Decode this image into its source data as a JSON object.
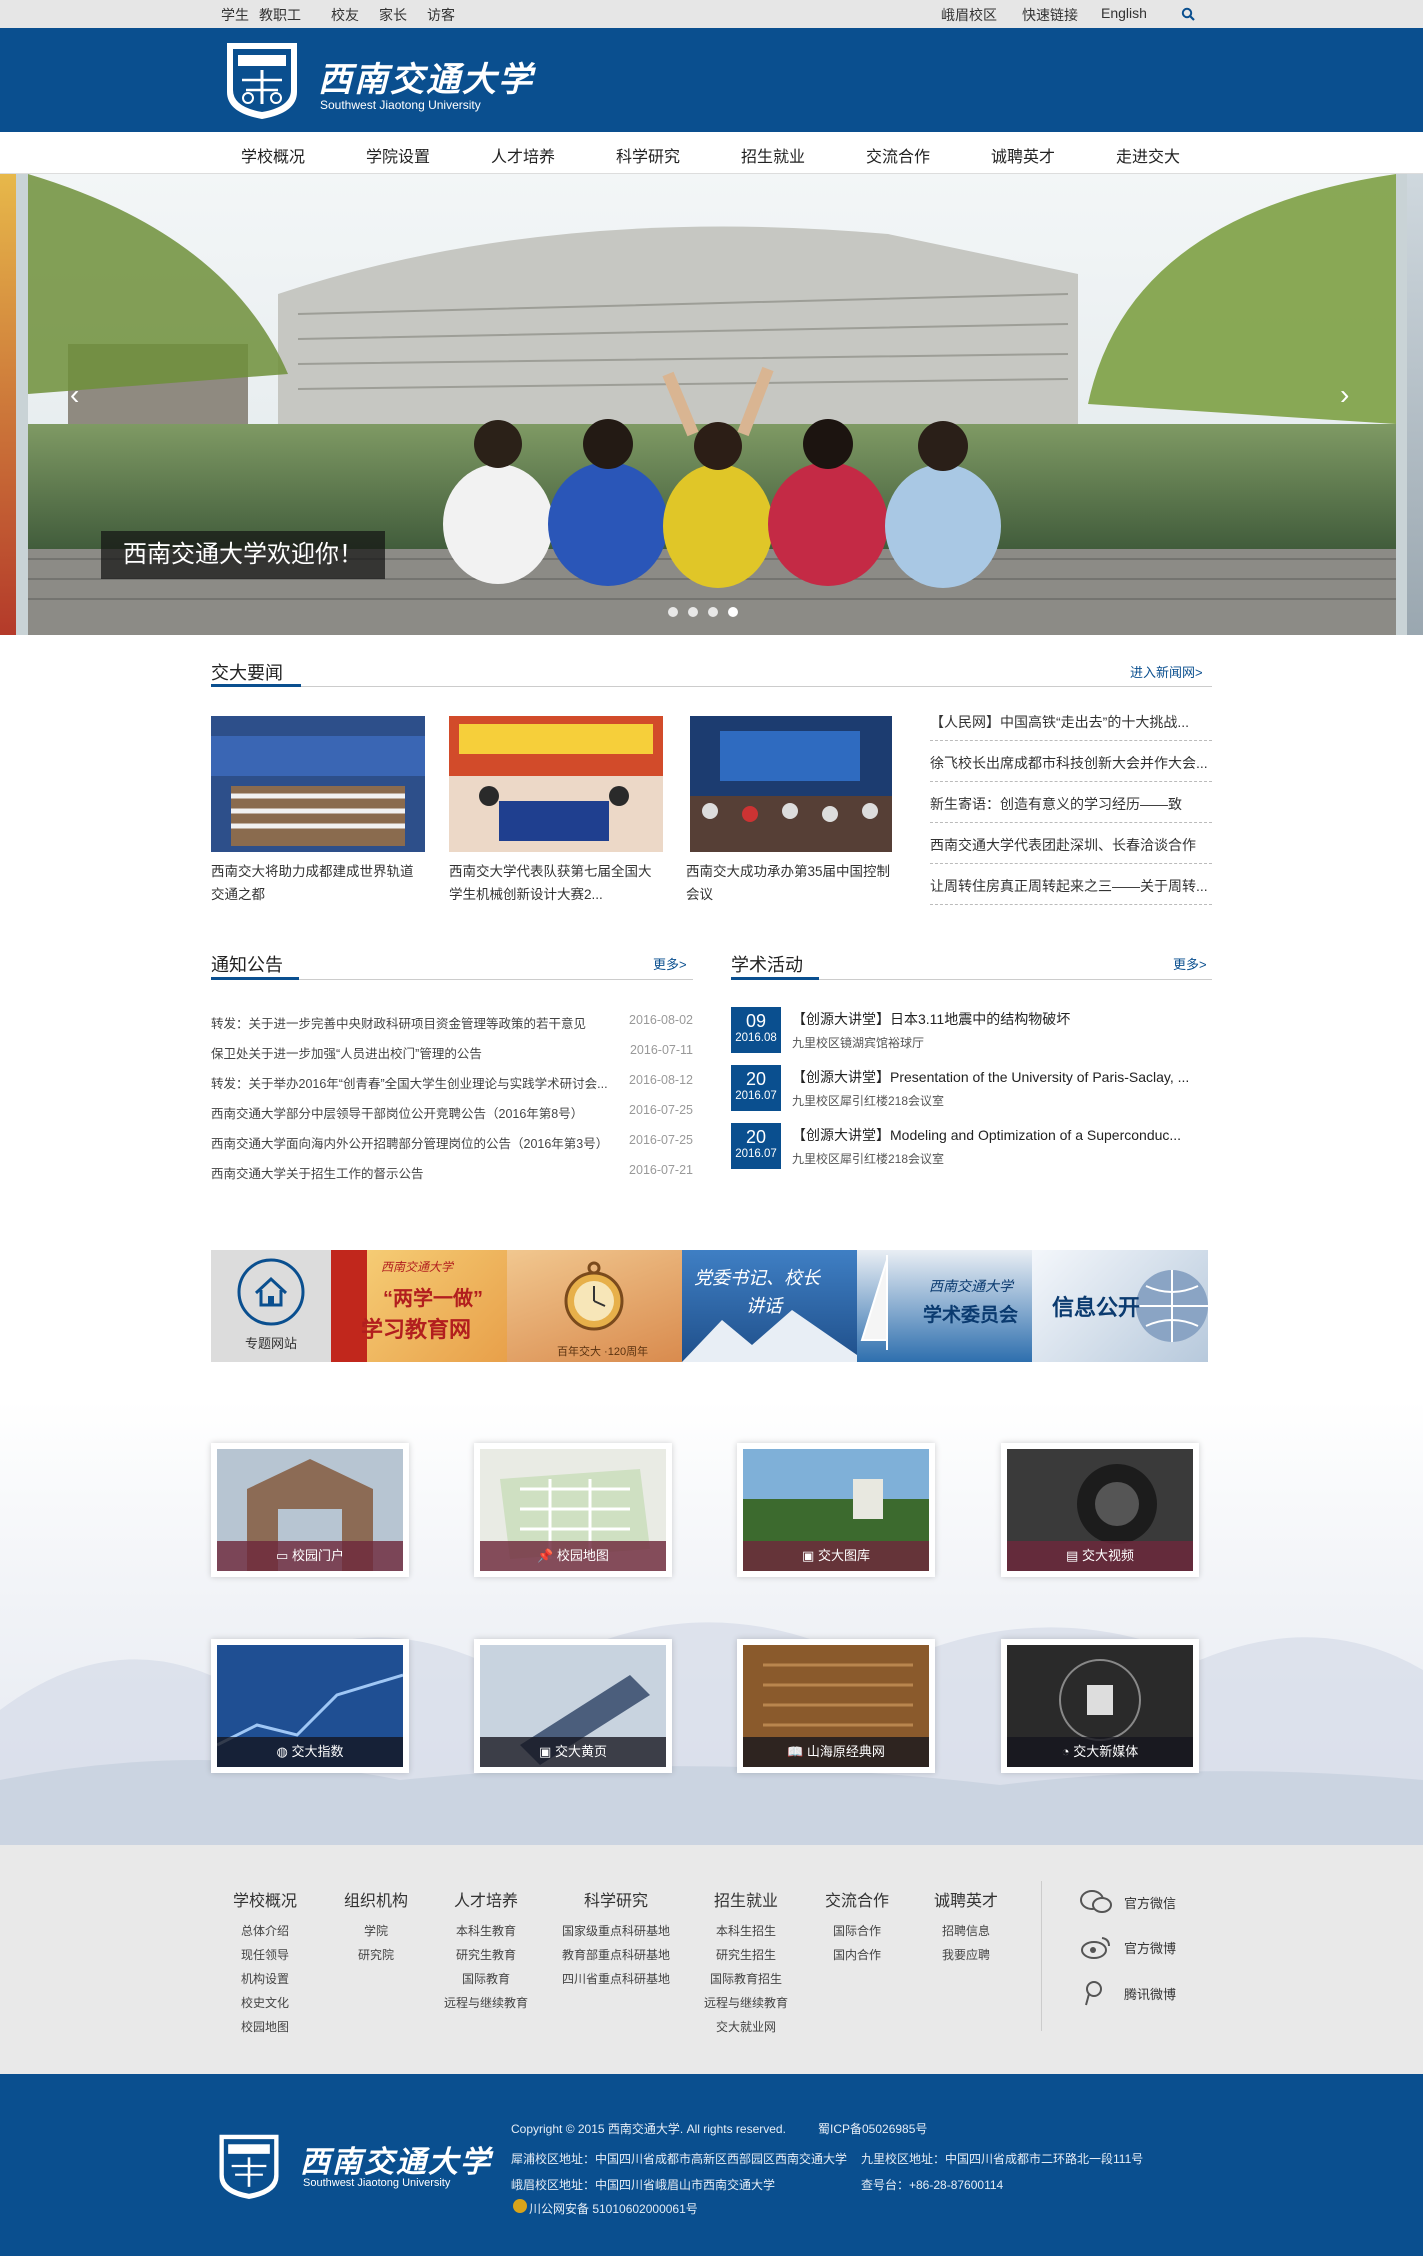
{
  "topbar": {
    "left": [
      "学生",
      "教职工",
      "校友",
      "家长",
      "访客"
    ],
    "campus": "峨眉校区",
    "quicklinks": "快速链接",
    "english": "English"
  },
  "logo": {
    "cn": "西南交通大学",
    "en": "Southwest Jiaotong University"
  },
  "nav": [
    "学校概况",
    "学院设置",
    "人才培养",
    "科学研究",
    "招生就业",
    "交流合作",
    "诚聘英才",
    "走进交大"
  ],
  "banner": {
    "caption": "西南交通大学欢迎你！"
  },
  "news": {
    "title": "交大要闻",
    "more": "进入新闻网>",
    "cards": [
      {
        "caption": "西南交大将助力成都建成世界轨道交通之都"
      },
      {
        "caption": "西南交大学代表队获第七届全国大学生机械创新设计大赛2..."
      },
      {
        "caption": "西南交大成功承办第35届中国控制会议"
      }
    ],
    "list": [
      "【人民网】中国高铁“走出去”的十大挑战...",
      "徐飞校长出席成都市科技创新大会并作大会...",
      "新生寄语：创造有意义的学习经历——致",
      "西南交通大学代表团赴深圳、长春洽谈合作",
      "让周转住房真正周转起来之三——关于周转..."
    ]
  },
  "notice": {
    "title": "通知公告",
    "more": "更多>",
    "items": [
      {
        "t": "转发：关于进一步完善中央财政科研项目资金管理等政策的若干意见",
        "d": "2016-08-02"
      },
      {
        "t": "保卫处关于进一步加强“人员进出校门”管理的公告",
        "d": "2016-07-11"
      },
      {
        "t": "转发：关于举办2016年“创青春”全国大学生创业理论与实践学术研讨会...",
        "d": "2016-08-12"
      },
      {
        "t": "西南交通大学部分中层领导干部岗位公开竞聘公告（2016年第8号）",
        "d": "2016-07-25"
      },
      {
        "t": "西南交通大学面向海内外公开招聘部分管理岗位的公告（2016年第3号）",
        "d": "2016-07-25"
      },
      {
        "t": "西南交通大学关于招生工作的督示公告",
        "d": "2016-07-21"
      }
    ]
  },
  "academic": {
    "title": "学术活动",
    "more": "更多>",
    "items": [
      {
        "dd": "09",
        "ym": "2016.08",
        "title": "【创源大讲堂】日本3.11地震中的结构物破坏",
        "loc": "九里校区镜湖宾馆裕球厅"
      },
      {
        "dd": "20",
        "ym": "2016.07",
        "title": "【创源大讲堂】Presentation of the University of Paris-Saclay, ...",
        "loc": "九里校区犀引红楼218会议室"
      },
      {
        "dd": "20",
        "ym": "2016.07",
        "title": "【创源大讲堂】Modeling and Optimization of a Superconduc...",
        "loc": "九里校区犀引红楼218会议室"
      }
    ]
  },
  "special": {
    "label": "专题网站",
    "banners": [
      {
        "l1": "西南交通大学",
        "l2": "“两学一做”",
        "l3": "学习教育网"
      },
      {
        "l1": "百年交大 ·120周年"
      },
      {
        "l1": "党委书记、校长",
        "l2": "讲话"
      },
      {
        "l1": "西南交通大学",
        "l2": "学术委员会"
      },
      {
        "l1": "信息公开"
      }
    ]
  },
  "tiles": [
    "校园门户",
    "校园地图",
    "交大图库",
    "交大视频",
    "交大指数",
    "交大黄页",
    "山海原经典网",
    "交大新媒体"
  ],
  "footernav": [
    {
      "h": "学校概况",
      "items": [
        "总体介绍",
        "现任领导",
        "机构设置",
        "校史文化",
        "校园地图"
      ]
    },
    {
      "h": "组织机构",
      "items": [
        "学院",
        "研究院"
      ]
    },
    {
      "h": "人才培养",
      "items": [
        "本科生教育",
        "研究生教育",
        "国际教育",
        "远程与继续教育"
      ]
    },
    {
      "h": "科学研究",
      "items": [
        "国家级重点科研基地",
        "教育部重点科研基地",
        "四川省重点科研基地"
      ]
    },
    {
      "h": "招生就业",
      "items": [
        "本科生招生",
        "研究生招生",
        "国际教育招生",
        "远程与继续教育",
        "交大就业网"
      ]
    },
    {
      "h": "交流合作",
      "items": [
        "国际合作",
        "国内合作"
      ]
    },
    {
      "h": "诚聘英才",
      "items": [
        "招聘信息",
        "我要应聘"
      ]
    }
  ],
  "social": [
    "官方微信",
    "官方微博",
    "腾讯微博"
  ],
  "footer": {
    "copyright": "Copyright © 2015 西南交通大学. All rights reserved.",
    "icp": "蜀ICP备05026985号",
    "addr1": "犀浦校区地址：中国四川省成都市高新区西部园区西南交通大学",
    "addr2": "九里校区地址：中国四川省成都市二环路北一段111号",
    "addr3": "峨眉校区地址：中国四川省峨眉山市西南交通大学",
    "tel": "查号台：+86-28-87600114",
    "police": "川公网安备 51010602000061号"
  },
  "colors": {
    "brand": "#0a4f8f",
    "topbar": "#e6e6e6",
    "footer_nav_bg": "#e9e9e9"
  }
}
